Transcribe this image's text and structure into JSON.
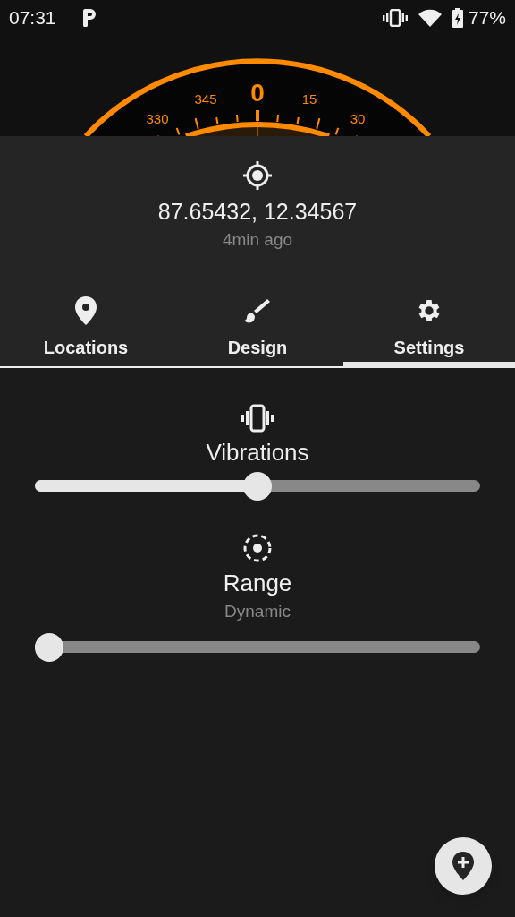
{
  "status_bar": {
    "time": "07:31",
    "battery": "77%"
  },
  "compass": {
    "labels": [
      "330",
      "345",
      "0",
      "15",
      "30"
    ]
  },
  "location": {
    "coordinates": "87.65432, 12.34567",
    "age": "4min ago"
  },
  "tabs": [
    {
      "label": "Locations",
      "selected": false
    },
    {
      "label": "Design",
      "selected": false
    },
    {
      "label": "Settings",
      "selected": true
    }
  ],
  "settings": [
    {
      "title": "Vibrations",
      "level": 0.5
    },
    {
      "title": "Range",
      "subtitle": "Dynamic",
      "level": 0
    }
  ]
}
